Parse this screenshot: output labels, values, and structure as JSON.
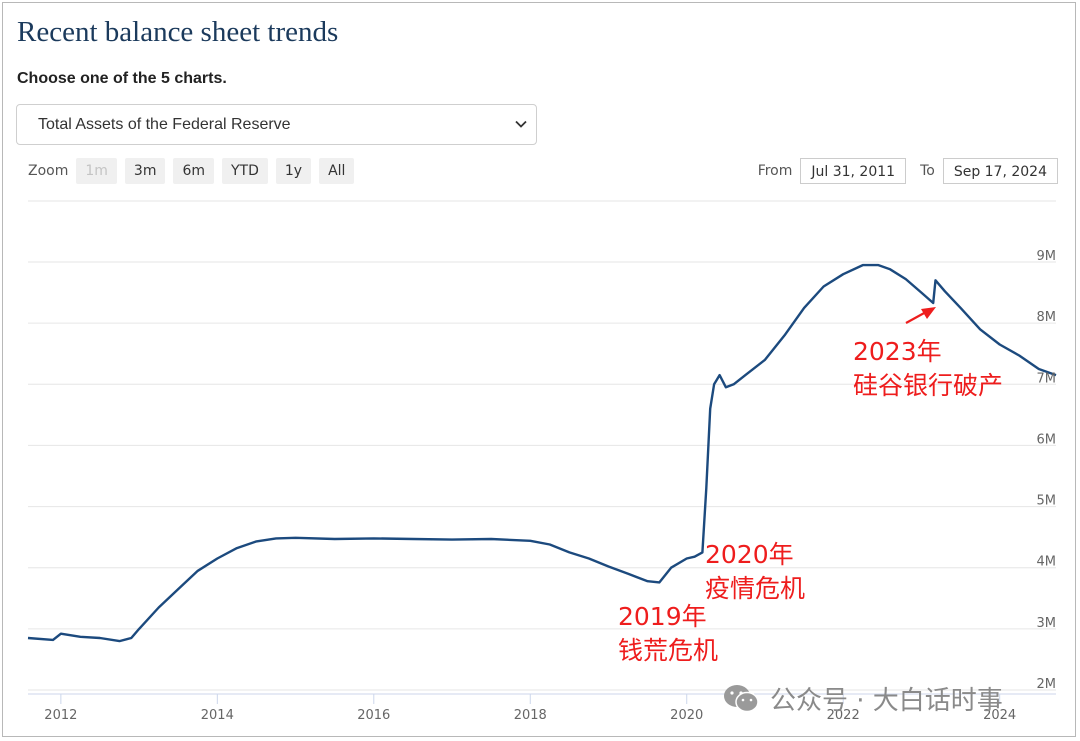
{
  "page": {
    "title": "Recent balance sheet trends",
    "subtitle": "Choose one of the 5 charts.",
    "selector": {
      "selected": "Total Assets of the Federal Reserve"
    }
  },
  "zoom": {
    "label": "Zoom",
    "buttons": [
      {
        "label": "1m",
        "disabled": true
      },
      {
        "label": "3m",
        "disabled": false
      },
      {
        "label": "6m",
        "disabled": false
      },
      {
        "label": "YTD",
        "disabled": false
      },
      {
        "label": "1y",
        "disabled": false
      },
      {
        "label": "All",
        "disabled": false
      }
    ]
  },
  "range": {
    "from_label": "From",
    "from": "Jul 31, 2011",
    "to_label": "To",
    "to": "Sep 17, 2024"
  },
  "watermark": {
    "text": "公众号 · 大白话时事",
    "icon": "wechat-icon"
  },
  "colors": {
    "line": "#1c4a7e",
    "annotation": "#ee1d1d",
    "grid": "#e6e6e6",
    "title": "#1b3a5c"
  },
  "chart_data": {
    "type": "line",
    "title": "",
    "xlabel": "",
    "ylabel": "",
    "grid": true,
    "yaxis_side": "right",
    "xlim": [
      2011.58,
      2024.72
    ],
    "ylim": [
      2000000,
      9000000
    ],
    "y_ticks": [
      2000000,
      3000000,
      4000000,
      5000000,
      6000000,
      7000000,
      8000000,
      9000000
    ],
    "y_tick_labels": [
      "2M",
      "3M",
      "4M",
      "5M",
      "6M",
      "7M",
      "8M",
      "9M"
    ],
    "x_ticks": [
      2012,
      2014,
      2016,
      2018,
      2020,
      2022,
      2024
    ],
    "x_tick_labels": [
      "2012",
      "2014",
      "2016",
      "2018",
      "2020",
      "2022",
      "2024"
    ],
    "series": [
      {
        "x": [
          2011.58,
          2011.9,
          2012.0,
          2012.25,
          2012.5,
          2012.75,
          2012.9,
          2013.0,
          2013.25,
          2013.5,
          2013.75,
          2014.0,
          2014.25,
          2014.5,
          2014.75,
          2015.0,
          2015.5,
          2016.0,
          2016.5,
          2017.0,
          2017.5,
          2018.0,
          2018.25,
          2018.5,
          2018.75,
          2019.0,
          2019.25,
          2019.5,
          2019.65,
          2019.8,
          2020.0,
          2020.1,
          2020.2,
          2020.25,
          2020.3,
          2020.35,
          2020.42,
          2020.5,
          2020.6,
          2020.75,
          2021.0,
          2021.25,
          2021.5,
          2021.75,
          2022.0,
          2022.25,
          2022.45,
          2022.6,
          2022.8,
          2023.0,
          2023.15,
          2023.18,
          2023.3,
          2023.5,
          2023.75,
          2024.0,
          2024.25,
          2024.5,
          2024.72
        ],
        "values": [
          2850000,
          2820000,
          2920000,
          2870000,
          2850000,
          2800000,
          2850000,
          3000000,
          3350000,
          3650000,
          3950000,
          4150000,
          4320000,
          4430000,
          4480000,
          4490000,
          4470000,
          4480000,
          4470000,
          4460000,
          4470000,
          4440000,
          4380000,
          4250000,
          4150000,
          4020000,
          3900000,
          3780000,
          3760000,
          4000000,
          4150000,
          4180000,
          4250000,
          5300000,
          6600000,
          7000000,
          7150000,
          6950000,
          7000000,
          7150000,
          7400000,
          7800000,
          8250000,
          8600000,
          8800000,
          8950000,
          8950000,
          8880000,
          8720000,
          8500000,
          8330000,
          8700000,
          8520000,
          8250000,
          7900000,
          7650000,
          7470000,
          7250000,
          7150000
        ]
      }
    ],
    "annotations": [
      {
        "lines": [
          "2019年",
          "钱荒危机"
        ]
      },
      {
        "lines": [
          "2020年",
          "疫情危机"
        ]
      },
      {
        "lines": [
          "2023年",
          "硅谷银行破产"
        ]
      }
    ]
  }
}
